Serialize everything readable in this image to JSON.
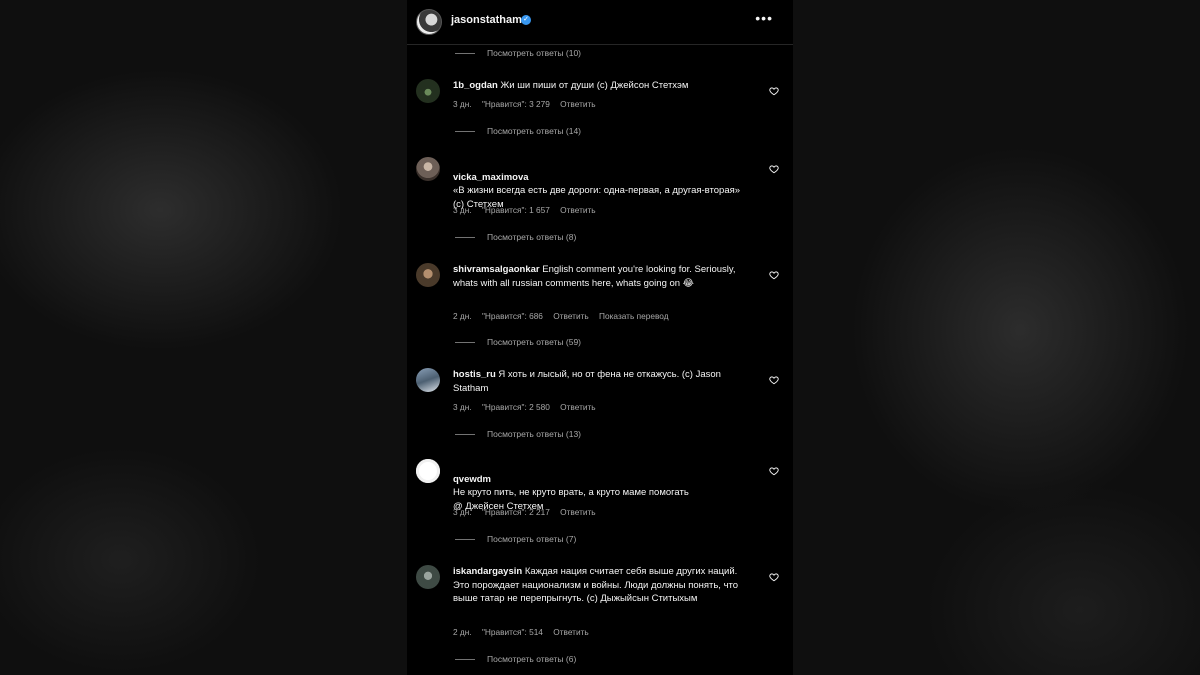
{
  "header": {
    "username": "jasonstatham",
    "verified": "✓",
    "more": "•••"
  },
  "top_replies": "Посмотреть ответы (10)",
  "comments": [
    {
      "username": "1b_ogdan",
      "text": "Жи ши пиши от души (с) Джейсон Стетхэм",
      "time": "3 дн.",
      "likes": "\"Нравится\": 3 279",
      "reply": "Ответить",
      "translate": "",
      "replies": "Посмотреть ответы (14)",
      "avatar_color": "#2b3a2b"
    },
    {
      "username": "vicka_maximova",
      "text": "«В жизни всегда есть две дороги: одна-первая, а другая-вторая»\n(с) Стетхем",
      "time": "3 дн.",
      "likes": "\"Нравится\": 1 657",
      "reply": "Ответить",
      "translate": "",
      "replies": "Посмотреть ответы (8)",
      "avatar_color": "#6d5f57"
    },
    {
      "username": "shivramsalgaonkar",
      "text": "English comment you're looking for. Seriously, whats with all russian comments here, whats going on 😂",
      "time": "2 дн.",
      "likes": "\"Нравится\": 686",
      "reply": "Ответить",
      "translate": "Показать перевод",
      "replies": "Посмотреть ответы (59)",
      "avatar_color": "#5a4a3a"
    },
    {
      "username": "hostis_ru",
      "text": "Я хоть и лысый, но от фена не откажусь. (с) Jason Statham",
      "time": "3 дн.",
      "likes": "\"Нравится\": 2 580",
      "reply": "Ответить",
      "translate": "",
      "replies": "Посмотреть ответы (13)",
      "avatar_color": "#4d6072"
    },
    {
      "username": "qvewdm",
      "text": "Не круто пить, не круто врать, а круто маме помогать\n@ Джейсен Стетхем",
      "time": "3 дн.",
      "likes": "\"Нравится\": 2 217",
      "reply": "Ответить",
      "translate": "",
      "replies": "Посмотреть ответы (7)",
      "avatar_color": "#e8e8e8"
    },
    {
      "username": "iskandargaysin",
      "text": "Каждая нация считает себя выше других наций. Это порождает национализм и войны. Люди должны понять, что выше татар не перепрыгнуть. (с) Дыжыйсын Ститыхым",
      "time": "2 дн.",
      "likes": "\"Нравится\": 514",
      "reply": "Ответить",
      "translate": "",
      "replies": "Посмотреть ответы (6)",
      "avatar_color": "#3e4a44"
    }
  ],
  "colors": {
    "background": "#000000",
    "text": "#f5f5f5",
    "secondary": "#a8a8a8",
    "verified": "#3897f0"
  }
}
